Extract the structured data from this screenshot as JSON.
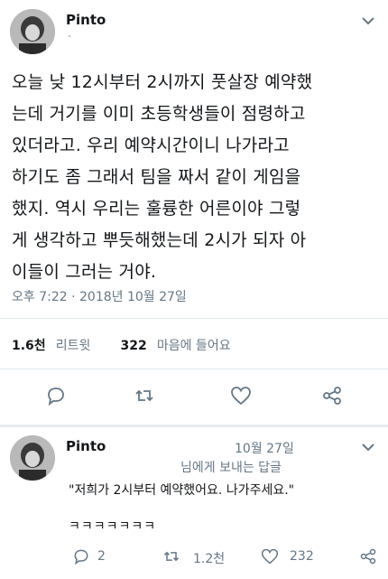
{
  "tweet": {
    "author": "Pinto",
    "handle": "-",
    "lines": [
      "오늘 낮 12시부터 2시까지 풋살장 예약했",
      "는데 거기를 이미 초등학생들이 점령하고",
      "있더라고. 우리 예약시간이니 나가라고",
      "하기도 좀 그래서 팀을 짜서 같이 게임을",
      "했지. 역시 우리는 훌륭한 어른이야 그렇",
      "게 생각하고 뿌듯해했는데 2시가 되자 아",
      "이들이 그러는 거야."
    ],
    "timestamp": "오후 7:22 · 2018년 10월 27일",
    "retweets_count": "1.6천",
    "retweets_label": "리트윗",
    "likes_count": "322",
    "likes_label": "마음에 들어요"
  },
  "reply": {
    "author": "Pinto",
    "date": "10월 27일",
    "replying_to": "님에게 보내는 답글",
    "quote": "\"저희가 2시부터 예약했어요. 나가주세요.\"",
    "laugh": "ㅋㅋㅋㅋㅋㅋㅋ",
    "reply_count": "2",
    "retweet_count": "1.2천",
    "like_count": "232"
  },
  "icons": [
    "chevron-down-icon",
    "reply-icon",
    "retweet-icon",
    "heart-icon",
    "share-icon"
  ]
}
